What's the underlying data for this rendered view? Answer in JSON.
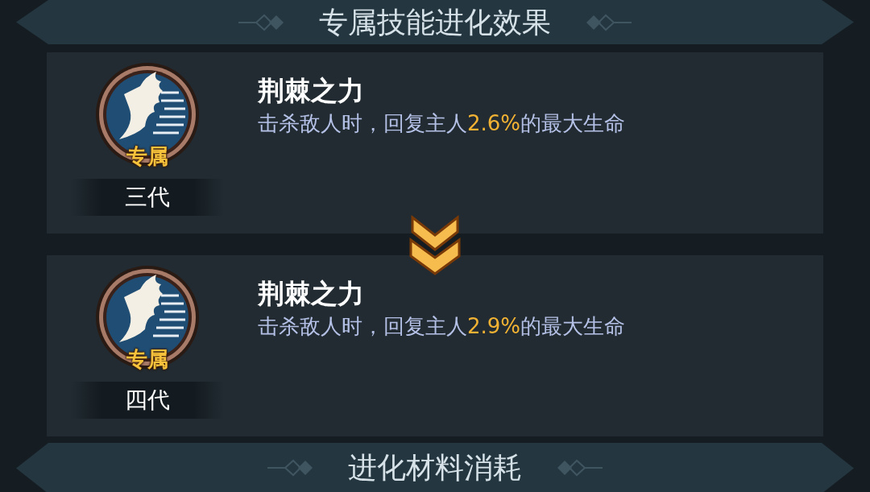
{
  "header": {
    "title": "专属技能进化效果"
  },
  "stages": [
    {
      "badge": "专属",
      "grade": "三代",
      "skill_name": "荆棘之力",
      "description": [
        {
          "text": "击杀敌人时，回复主人",
          "highlight": false
        },
        {
          "text": "2.6%",
          "highlight": true
        },
        {
          "text": "的最大生命",
          "highlight": false
        }
      ]
    },
    {
      "badge": "专属",
      "grade": "四代",
      "skill_name": "荆棘之力",
      "description": [
        {
          "text": "击杀敌人时，回复主人",
          "highlight": false
        },
        {
          "text": "2.9%",
          "highlight": true
        },
        {
          "text": "的最大生命",
          "highlight": false
        }
      ]
    }
  ],
  "footer": {
    "title": "进化材料消耗"
  }
}
